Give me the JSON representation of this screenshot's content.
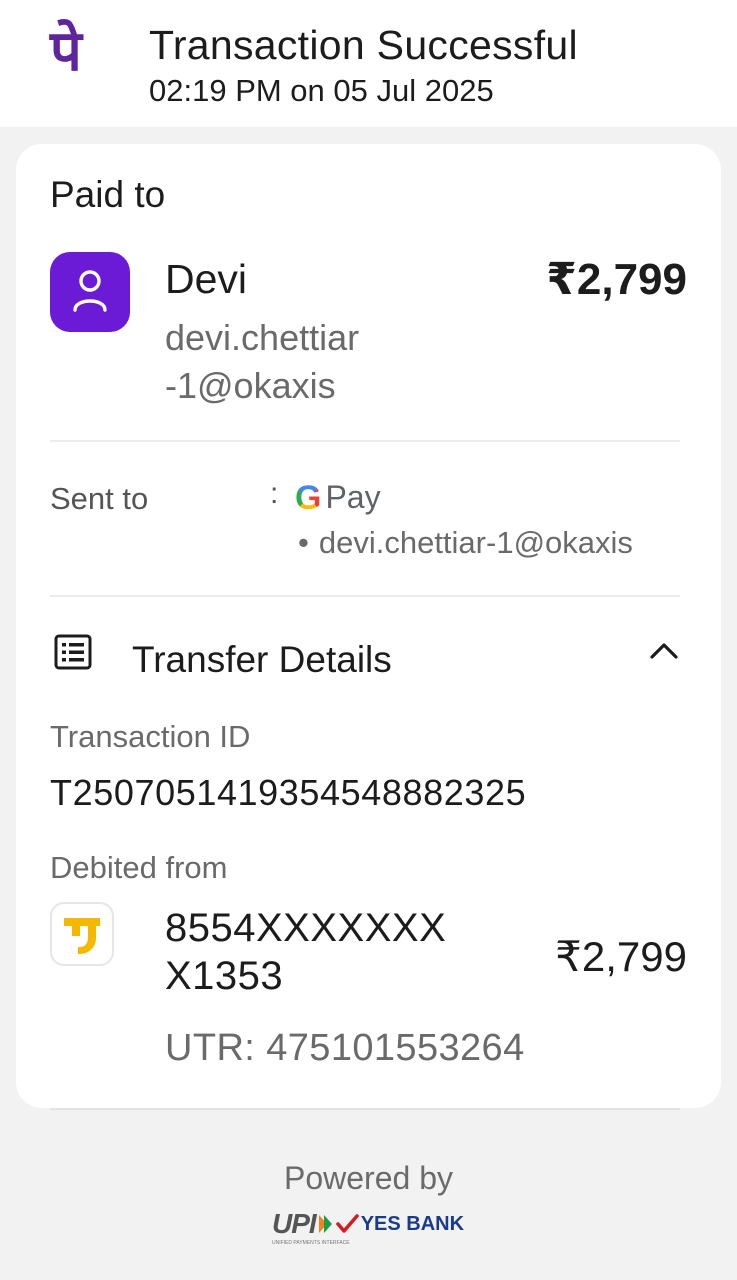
{
  "header": {
    "logo": "पे",
    "title": "Transaction Successful",
    "datetime": "02:19 PM on 05 Jul 2025"
  },
  "payment": {
    "paid_to_label": "Paid to",
    "payee_name": "Devi",
    "payee_vpa": "devi.chettiar -1@okaxis",
    "amount": "₹2,799"
  },
  "sent_to": {
    "label": "Sent to",
    "separator": ":",
    "app_g": "G",
    "app_pay": "Pay",
    "bullet": "•",
    "vpa": "devi.chettiar-1@okaxis"
  },
  "transfer_details": {
    "title": "Transfer Details",
    "transaction_id_label": "Transaction ID",
    "transaction_id": "T2507051419354548882325",
    "debited_from_label": "Debited from",
    "account": "8554XXXXXXX X1353",
    "amount": "₹2,799",
    "utr": "UTR: 475101553264"
  },
  "footer": {
    "powered_by": "Powered by",
    "upi": "UPI",
    "upi_sub": "UNIFIED PAYMENTS INTERFACE",
    "bank": "YES BANK"
  },
  "colors": {
    "brand": "#5f259f",
    "avatar": "#6b1bd6",
    "bank_logo": "#f5b800",
    "yes_bank_red": "#d71920",
    "yes_bank_blue": "#1a3b8c"
  },
  "icons": {
    "header_logo": "phonepe-logo",
    "avatar": "user-icon",
    "transfer": "receipt-list-icon",
    "collapse": "chevron-up-icon",
    "bank": "bank-logo-icon"
  }
}
